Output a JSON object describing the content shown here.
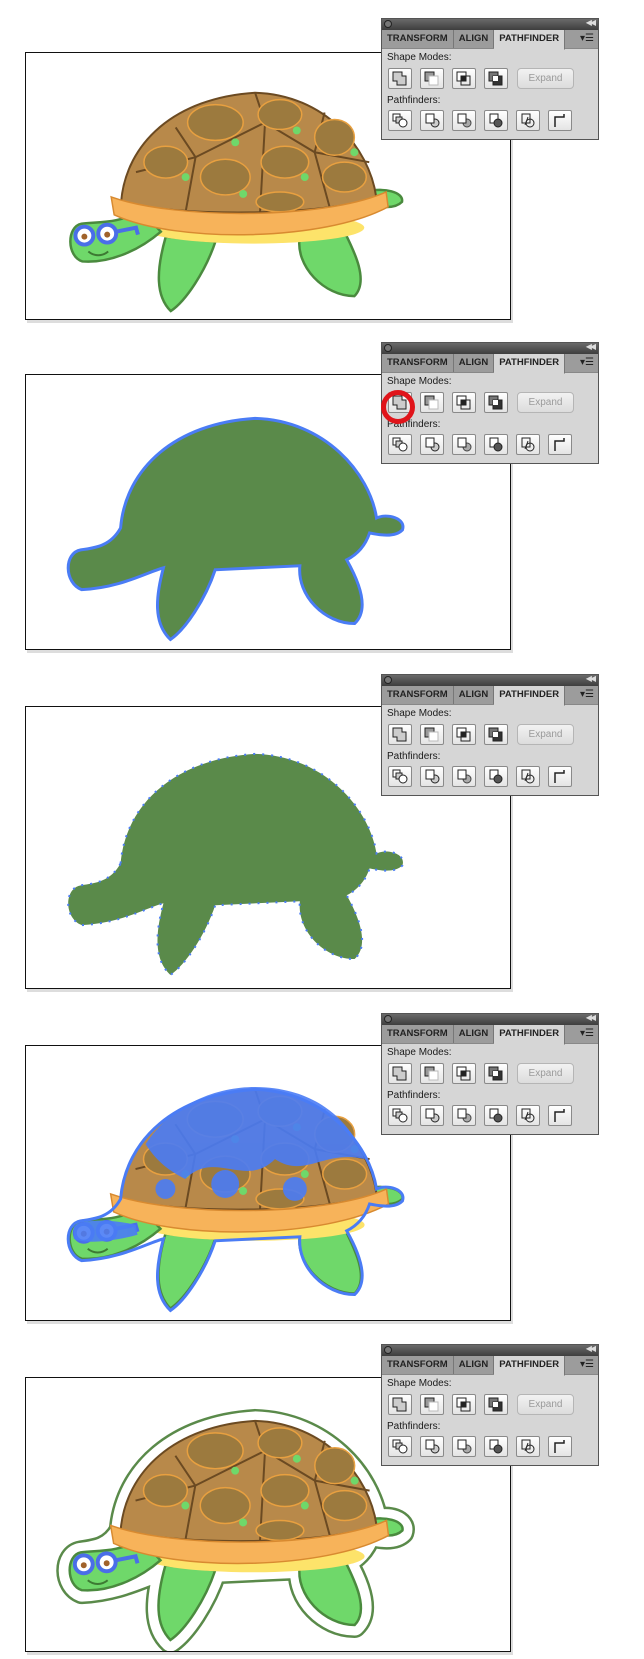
{
  "panel": {
    "tabs": [
      {
        "label": "TRANSFORM",
        "active": false
      },
      {
        "label": "ALIGN",
        "active": false
      },
      {
        "label": "PATHFINDER",
        "active": true
      }
    ],
    "shape_modes_label": "Shape Modes:",
    "pathfinders_label": "Pathfinders:",
    "expand_label": "Expand",
    "shape_mode_buttons": [
      "unite-icon",
      "minus-front-icon",
      "intersect-icon",
      "exclude-icon"
    ],
    "pathfinder_buttons": [
      "divide-icon",
      "trim-icon",
      "merge-icon",
      "crop-icon",
      "outline-icon",
      "minus-back-icon"
    ]
  },
  "steps": [
    {
      "state": "original-artwork"
    },
    {
      "state": "unite-selected",
      "highlighted_button": "unite-icon"
    },
    {
      "state": "united-silhouette"
    },
    {
      "state": "partial-selection"
    },
    {
      "state": "offset-outline-result"
    }
  ],
  "colors": {
    "selection": "#4a7cf5",
    "highlight": "#e0141a",
    "silhouette": "#5a8a4a"
  }
}
